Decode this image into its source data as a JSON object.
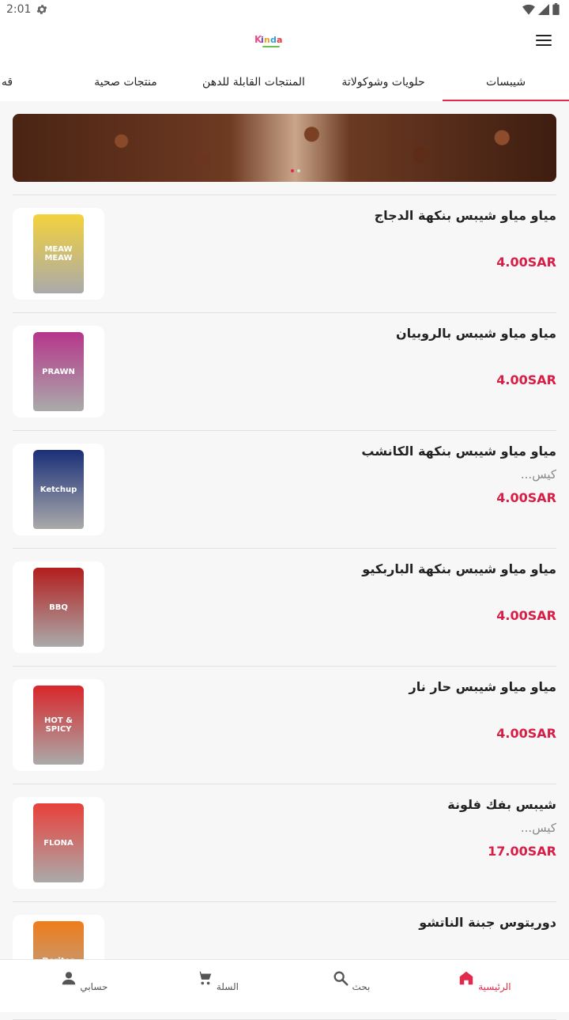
{
  "status": {
    "time": "2:01"
  },
  "tabs": [
    {
      "label": "شيبسات",
      "active": true
    },
    {
      "label": "حلويات وشوكولاتة",
      "active": false
    },
    {
      "label": "المنتجات القابلة للدهن",
      "active": false
    },
    {
      "label": "منتجات صحية",
      "active": false
    },
    {
      "label": "قه",
      "active": false
    }
  ],
  "products": [
    {
      "name": "مياو مياو شيبس بنكهة الدجاج",
      "desc": "",
      "price": "4.00SAR",
      "bag_color": "#f3d23c",
      "bag_text": "MEAW MEAW"
    },
    {
      "name": "مياو مياو شيبس بالروبيان",
      "desc": "",
      "price": "4.00SAR",
      "bag_color": "#b5368a",
      "bag_text": "PRAWN"
    },
    {
      "name": "مياو مياو شيبس بنكهة الكانشب",
      "desc": "كيس...",
      "price": "4.00SAR",
      "bag_color": "#1a2f78",
      "bag_text": "Ketchup"
    },
    {
      "name": "مياو مياو شيبس بنكهة الباربكيو",
      "desc": "",
      "price": "4.00SAR",
      "bag_color": "#b31d1d",
      "bag_text": "BBQ"
    },
    {
      "name": "مياو مياو شيبس حار نار",
      "desc": "",
      "price": "4.00SAR",
      "bag_color": "#d8262a",
      "bag_text": "HOT & SPICY"
    },
    {
      "name": "شيبس بفك فلونة",
      "desc": "كيس...",
      "price": "17.00SAR",
      "bag_color": "#e8403a",
      "bag_text": "FLONA"
    },
    {
      "name": "دوريتوس جبنة الناتشو",
      "desc": "",
      "price": "",
      "bag_color": "#ef7d1a",
      "bag_text": "Doritos"
    }
  ],
  "nav": [
    {
      "label": "الرئيسية",
      "icon": "home-icon",
      "active": true
    },
    {
      "label": "بحث",
      "icon": "search-icon",
      "active": false
    },
    {
      "label": "السلة",
      "icon": "cart-icon",
      "active": false
    },
    {
      "label": "حسابي",
      "icon": "person-icon",
      "active": false
    }
  ],
  "colors": {
    "accent": "#e0294b",
    "price": "#d81e46"
  }
}
